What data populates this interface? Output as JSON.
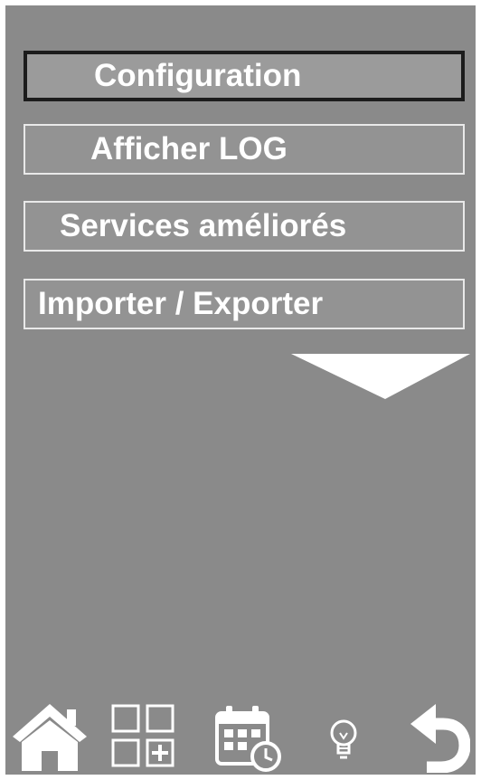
{
  "menu": {
    "items": [
      {
        "label": "Configuration",
        "selected": true
      },
      {
        "label": "Afficher LOG",
        "selected": false
      },
      {
        "label": "Services améliorés",
        "selected": false
      },
      {
        "label": "Importer / Exporter",
        "selected": false
      }
    ],
    "scroll_icon": "triangle-down-icon"
  },
  "toolbar": {
    "icons": [
      "home-icon",
      "grid-add-icon",
      "calendar-clock-icon",
      "lightbulb-icon",
      "back-arrow-icon"
    ]
  },
  "colors": {
    "background": "#8a8a8a",
    "button_fill": "#939393",
    "button_border": "#e9e9e9",
    "selected_border": "#1c1c1c",
    "text": "#ffffff"
  }
}
